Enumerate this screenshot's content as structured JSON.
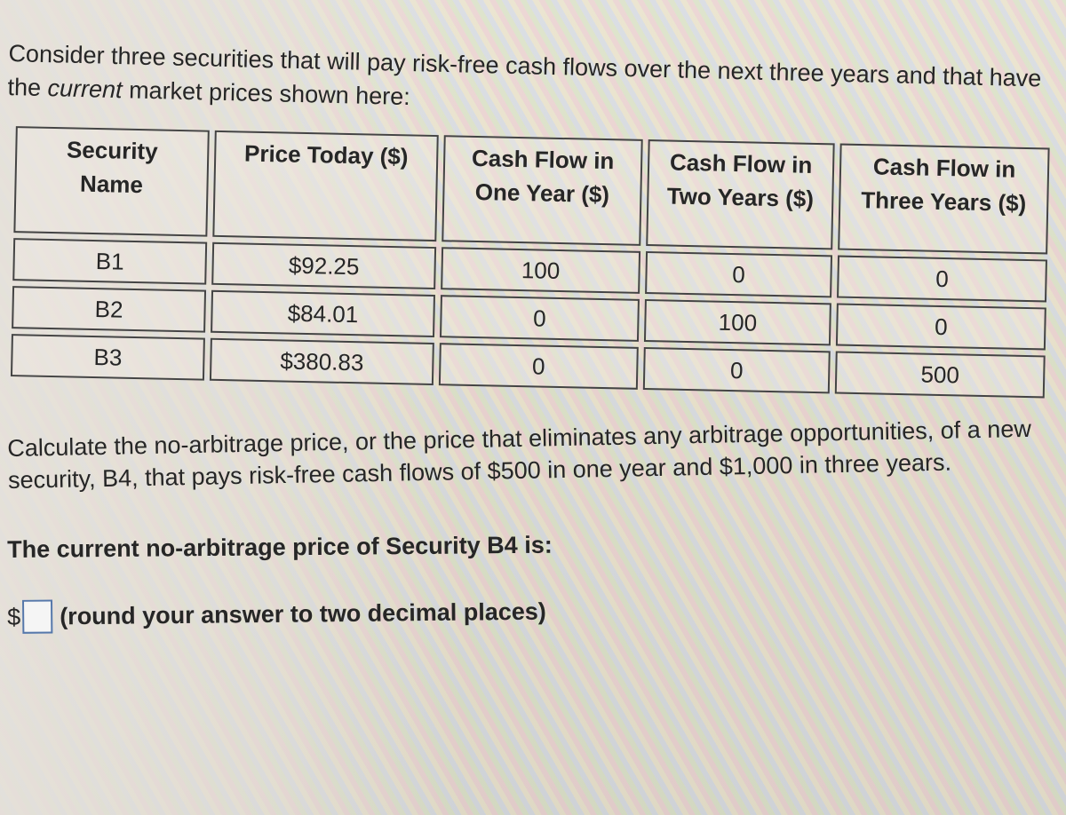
{
  "intro": {
    "text_before": "Consider three securities that will pay risk-free cash flows over the next three years and that have the ",
    "emphasis": "current",
    "text_after": " market prices shown here:"
  },
  "table": {
    "headers": [
      [
        "Security",
        "Name"
      ],
      [
        "Price Today ($)"
      ],
      [
        "Cash Flow in",
        "One Year ($)"
      ],
      [
        "Cash Flow in",
        "Two Years ($)"
      ],
      [
        "Cash Flow in",
        "Three Years ($)"
      ]
    ],
    "rows": [
      [
        "B1",
        "$92.25",
        "100",
        "0",
        "0"
      ],
      [
        "B2",
        "$84.01",
        "0",
        "100",
        "0"
      ],
      [
        "B3",
        "$380.83",
        "0",
        "0",
        "500"
      ]
    ]
  },
  "question": "Calculate the no-arbitrage price, or the price that eliminates any arbitrage opportunities, of a new security, B4, that pays risk-free cash flows of $500 in one year and $1,000 in three years.",
  "prompt": "The current no-arbitrage price of Security B4 is:",
  "answer": {
    "currency": "$",
    "value": "",
    "hint": "(round your answer to two decimal places)"
  }
}
